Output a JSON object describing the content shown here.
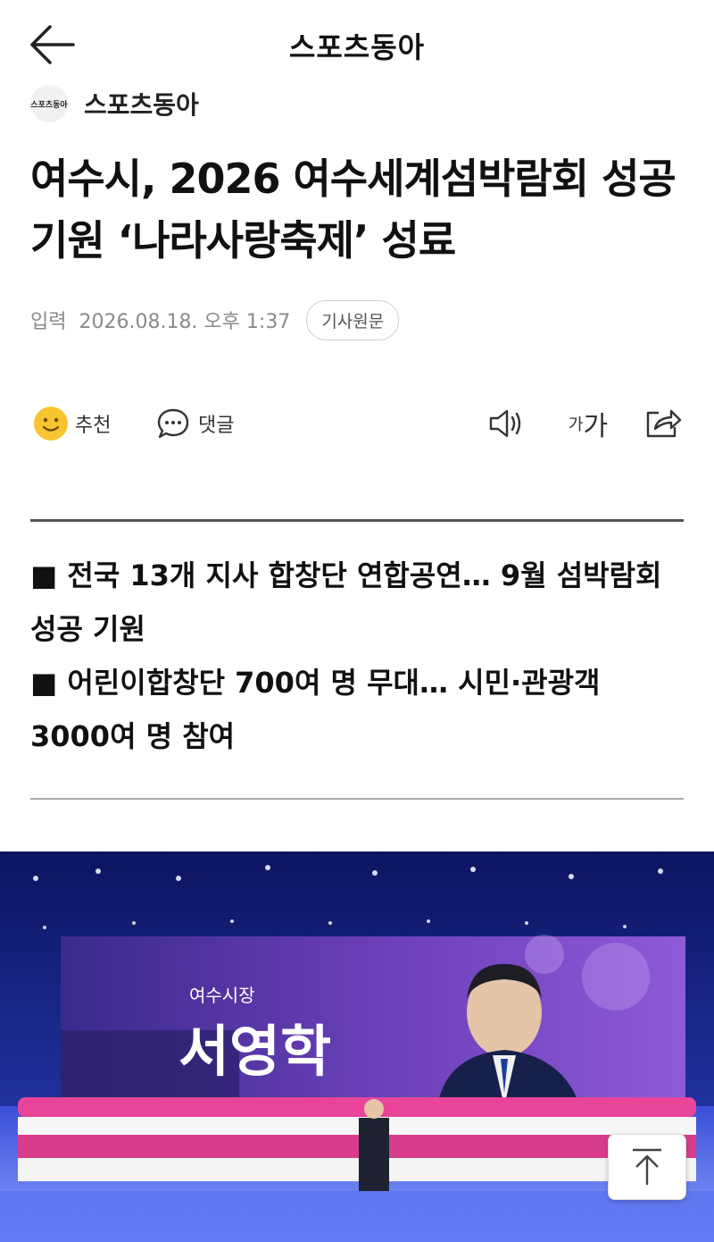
{
  "header": {
    "title": "스포츠동아",
    "back_icon": "arrow-left-icon"
  },
  "source": {
    "logo_text": "스포츠동아",
    "name": "스포츠동아"
  },
  "article": {
    "headline": "여수시, 2026 여수세계섬박람회 성공 기원 ‘나라사랑축제’ 성료",
    "meta_label": "입력",
    "date": "2026.08.18. 오후 1:37",
    "original_button": "기사원문"
  },
  "actions": {
    "recommend_label": "추천",
    "comment_label": "댓글",
    "font_size_small": "가",
    "font_size_big": "가",
    "icons": [
      "smile-icon",
      "comment-bubble-icon",
      "speaker-icon",
      "share-icon"
    ]
  },
  "summary": [
    "■ 전국 13개 지사 합창단 연합공연… 9월 섬박람회 성공 기원",
    "■ 어린이합창단 700여 명 무대… 시민·관광객 3000여 명 참여"
  ],
  "photo": {
    "screen_subtitle": "여수시장",
    "screen_name": "서영학"
  },
  "scroll_top_icon": "arrow-up-icon",
  "colors": {
    "accent_yellow": "#f7c531",
    "stage_blue": "#1b2a8f",
    "screen_purple": "#6a3fb8",
    "choir_pink": "#e8449a"
  }
}
